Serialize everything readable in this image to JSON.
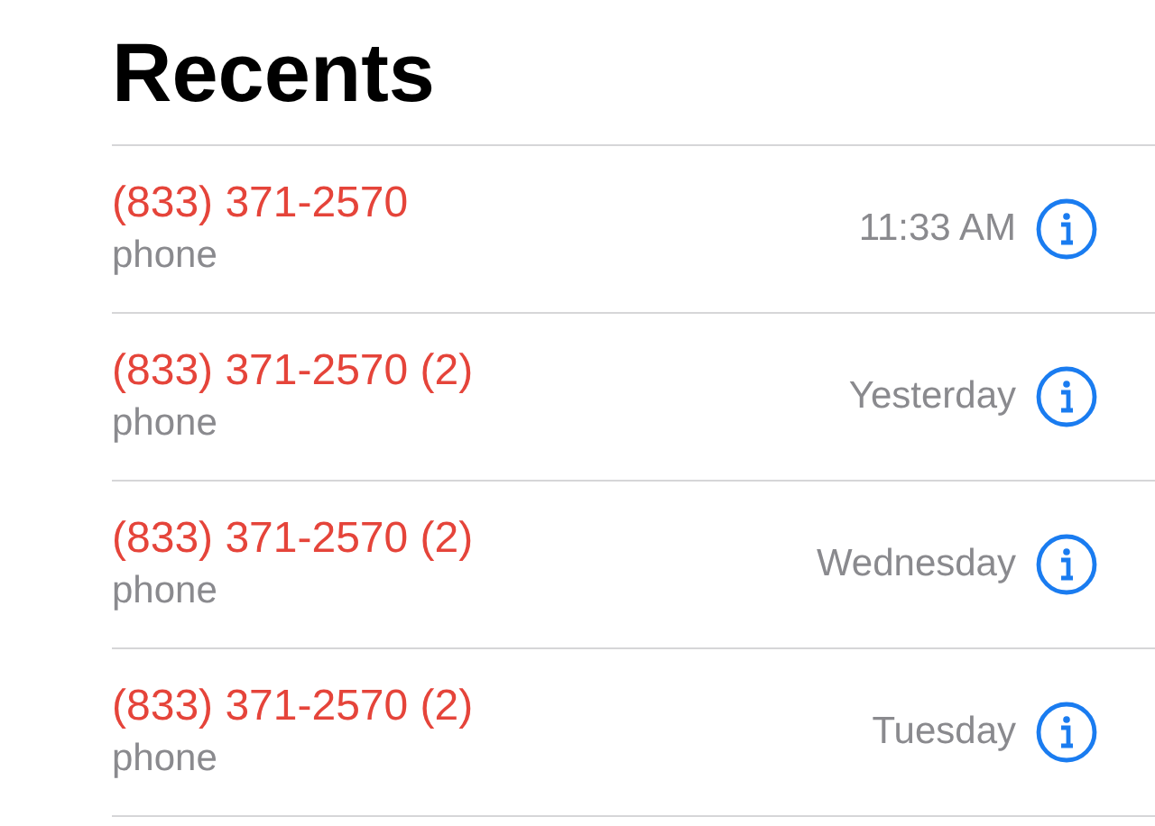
{
  "title": "Recents",
  "calls": [
    {
      "name": "(833) 371-2570",
      "missed": true,
      "type": "phone",
      "time": "11:33 AM"
    },
    {
      "name": "(833) 371-2570 (2)",
      "missed": true,
      "type": "phone",
      "time": "Yesterday"
    },
    {
      "name": "(833) 371-2570 (2)",
      "missed": true,
      "type": "phone",
      "time": "Wednesday"
    },
    {
      "name": "(833) 371-2570 (2)",
      "missed": true,
      "type": "phone",
      "time": "Tuesday"
    }
  ]
}
